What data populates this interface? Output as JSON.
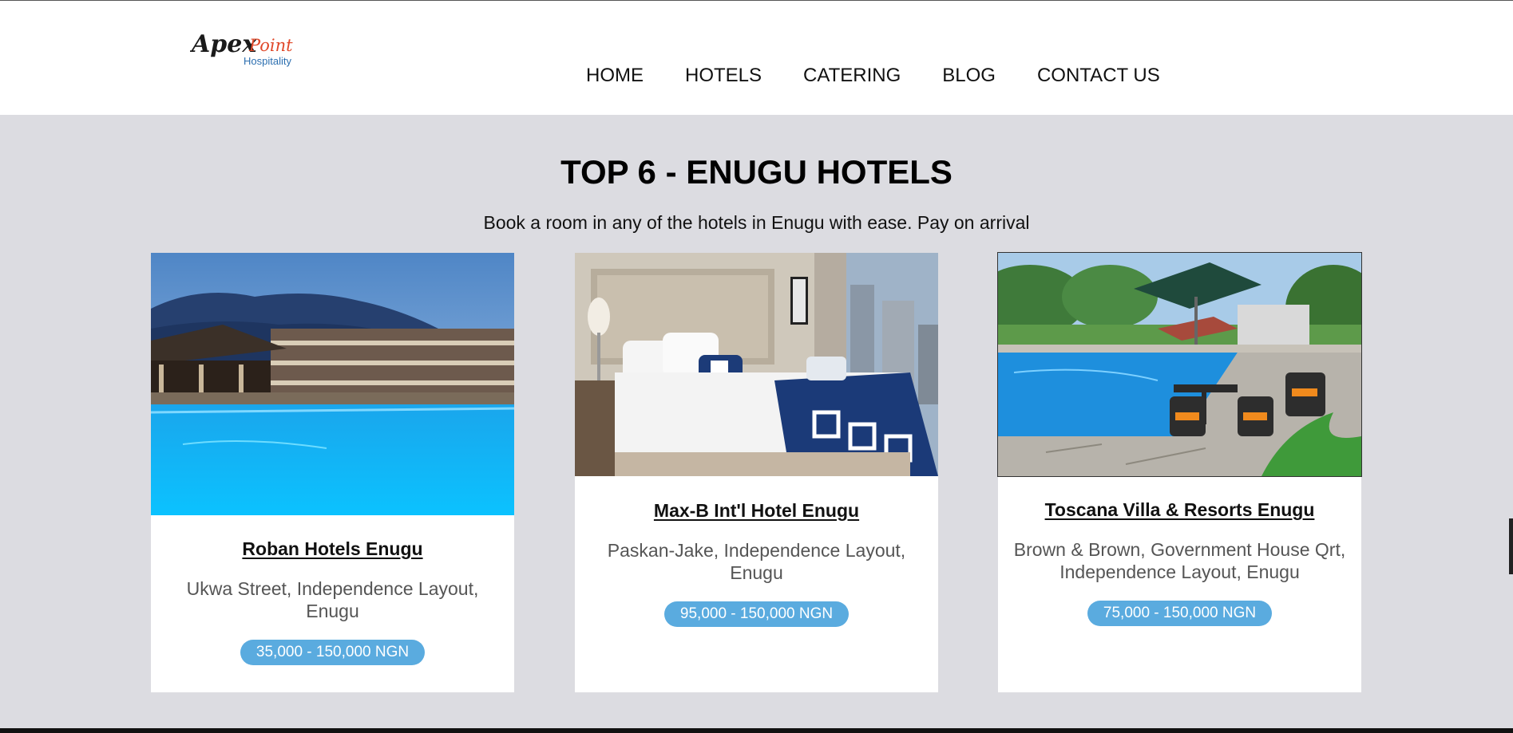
{
  "brand": {
    "logo_script": "Apex",
    "logo_script_accent": "Point",
    "logo_sub": "Hospitality",
    "colors": {
      "script": "#1a1a1a",
      "accent": "#e0492a",
      "sub": "#2c6fb0"
    }
  },
  "nav": {
    "items": [
      {
        "label": "HOME"
      },
      {
        "label": "HOTELS"
      },
      {
        "label": "CATERING"
      },
      {
        "label": "BLOG"
      },
      {
        "label": "CONTACT US"
      }
    ]
  },
  "main": {
    "title": "TOP 6 - ENUGU HOTELS",
    "subtitle": "Book a room in any of the hotels in Enugu with ease. Pay on arrival",
    "hotels": [
      {
        "name": "Roban Hotels Enugu",
        "address": "Ukwa Street, Independence Layout, Enugu",
        "price": "35,000 - 150,000 NGN",
        "photo_icon": "resort-pool-photo"
      },
      {
        "name": "Max-B Int'l Hotel Enugu",
        "address": "Paskan-Jake, Independence Layout, Enugu",
        "price": "95,000 - 150,000 NGN",
        "photo_icon": "hotel-bedroom-photo"
      },
      {
        "name": "Toscana Villa & Resorts Enugu",
        "address": "Brown & Brown, Government House Qrt, Independence Layout, Enugu",
        "price": "75,000 - 150,000 NGN",
        "photo_icon": "poolside-patio-photo"
      }
    ]
  },
  "theme": {
    "page_bg": "#dcdce1",
    "price_badge": "#5aabdf"
  }
}
